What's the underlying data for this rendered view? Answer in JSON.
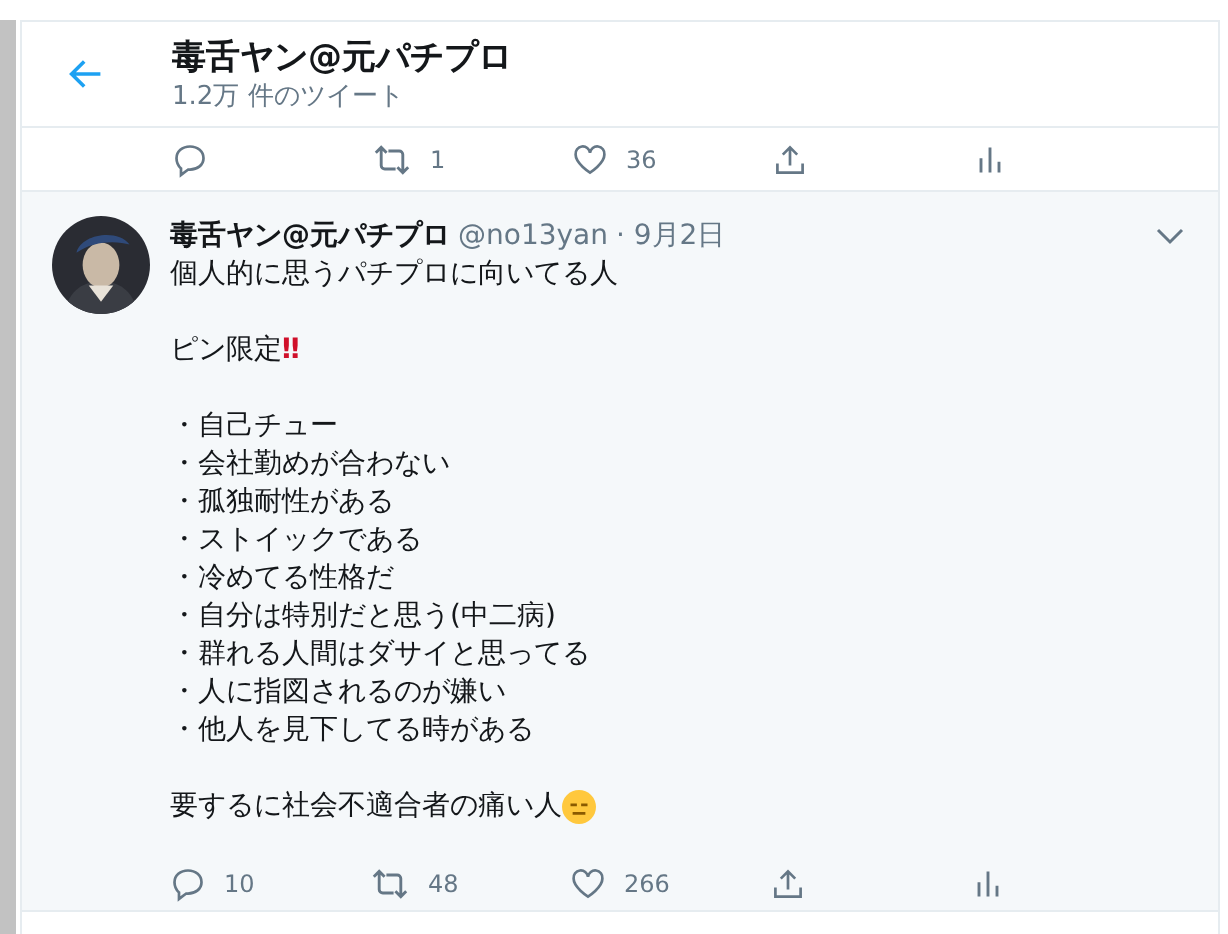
{
  "header": {
    "title": "毒舌ヤン@元パチプロ",
    "subtitle": "1.2万 件のツイート"
  },
  "previous_actions": [
    {
      "kind": "reply"
    },
    {
      "kind": "retweet",
      "count": "1"
    },
    {
      "kind": "like",
      "count": "36"
    },
    {
      "kind": "share"
    },
    {
      "kind": "analytics"
    }
  ],
  "tweet": {
    "name": "毒舌ヤン@元パチプロ",
    "handle": "@no13yan",
    "date": "· 9月2日",
    "paragraphs": [
      [
        {
          "text": "個人的に思うパチプロに向いてる人"
        }
      ],
      [
        {
          "text": "ピン限定",
          "emoji": "‼"
        }
      ],
      [
        {
          "text": "・自己チュー"
        },
        {
          "text": "・会社勤めが合わない"
        },
        {
          "text": "・孤独耐性がある"
        },
        {
          "text": "・ストイックである"
        },
        {
          "text": "・冷めてる性格だ"
        },
        {
          "text": "・自分は特別だと思う(中二病)"
        },
        {
          "text": "・群れる人間はダサイと思ってる"
        },
        {
          "text": "・人に指図されるのが嫌い"
        },
        {
          "text": "・他人を見下してる時がある"
        }
      ],
      [
        {
          "text": "要するに社会不適合者の痛い人",
          "kind": "face"
        }
      ]
    ],
    "actions": [
      {
        "kind": "reply",
        "count": "10"
      },
      {
        "kind": "retweet",
        "count": "48"
      },
      {
        "kind": "like",
        "count": "266"
      },
      {
        "kind": "share"
      },
      {
        "kind": "analytics"
      }
    ]
  }
}
